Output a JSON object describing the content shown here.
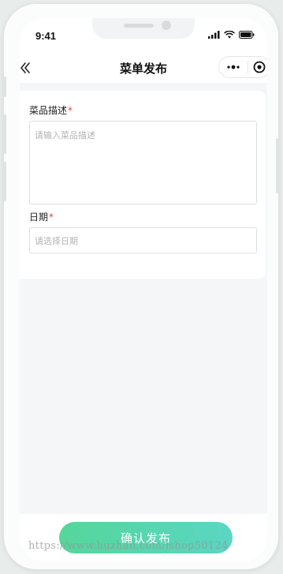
{
  "status_bar": {
    "time": "9:41",
    "icons": [
      "signal-icon",
      "wifi-icon",
      "battery-icon"
    ]
  },
  "nav": {
    "title": "菜单发布",
    "back_icon": "double-chevron-left-icon",
    "more_icon": "more-dots-icon",
    "close_icon": "target-circle-icon"
  },
  "form": {
    "description": {
      "label": "菜品描述",
      "required_mark": "*",
      "placeholder": "请输入菜品描述",
      "value": ""
    },
    "date": {
      "label": "日期",
      "required_mark": "*",
      "placeholder": "请选择日期",
      "value": ""
    }
  },
  "actions": {
    "submit_label": "确认发布"
  },
  "watermark": "https://www.huzhan.com/ishop50124",
  "colors": {
    "accent_start": "#55d69a",
    "accent_end": "#5ad6c4",
    "required": "#e0413a"
  }
}
